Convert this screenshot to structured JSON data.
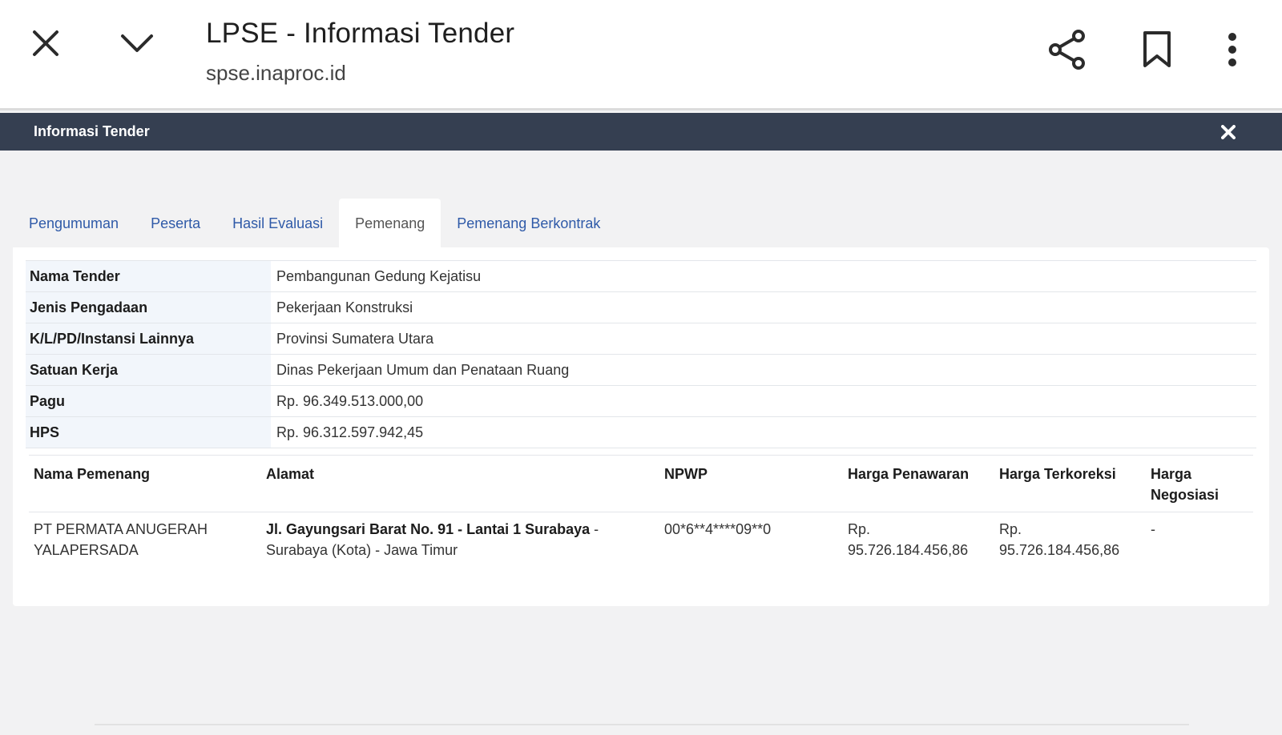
{
  "browser": {
    "title": "LPSE - Informasi Tender",
    "url": "spse.inaproc.id",
    "icons": {
      "close": "close-icon",
      "collapse": "chevron-down-icon",
      "share": "share-icon",
      "bookmark": "bookmark-icon",
      "more": "more-vert-icon"
    }
  },
  "modal": {
    "title": "Informasi Tender",
    "close_icon": "close-icon"
  },
  "tabs": [
    {
      "label": "Pengumuman",
      "active": false
    },
    {
      "label": "Peserta",
      "active": false
    },
    {
      "label": "Hasil Evaluasi",
      "active": false
    },
    {
      "label": "Pemenang",
      "active": true
    },
    {
      "label": "Pemenang Berkontrak",
      "active": false
    }
  ],
  "info": [
    {
      "label": "Nama Tender",
      "value": "Pembangunan Gedung Kejatisu"
    },
    {
      "label": "Jenis Pengadaan",
      "value": "Pekerjaan Konstruksi"
    },
    {
      "label": "K/L/PD/Instansi Lainnya",
      "value": "Provinsi Sumatera Utara"
    },
    {
      "label": "Satuan Kerja",
      "value": "Dinas Pekerjaan Umum dan Penataan Ruang"
    },
    {
      "label": "Pagu",
      "value": "Rp. 96.349.513.000,00"
    },
    {
      "label": "HPS",
      "value": "Rp. 96.312.597.942,45"
    }
  ],
  "winners": {
    "headers": [
      "Nama Pemenang",
      "Alamat",
      "NPWP",
      "Harga Penawaran",
      "Harga Terkoreksi",
      "Harga Negosiasi"
    ],
    "rows": [
      {
        "name": "PT PERMATA ANUGERAH YALAPERSADA",
        "address_bold": "Jl. Gayungsari Barat No. 91 - Lantai 1 Surabaya",
        "address_rest": " - Surabaya (Kota) - Jawa Timur",
        "npwp": "00*6**4****09**0",
        "offer": "Rp. 95.726.184.456,86",
        "corrected": "Rp. 95.726.184.456,86",
        "negotiated": "-"
      }
    ]
  },
  "colors": {
    "modal_header": "#353f51",
    "tab_link": "#2f5aa8",
    "label_bg": "#f2f6fb"
  }
}
